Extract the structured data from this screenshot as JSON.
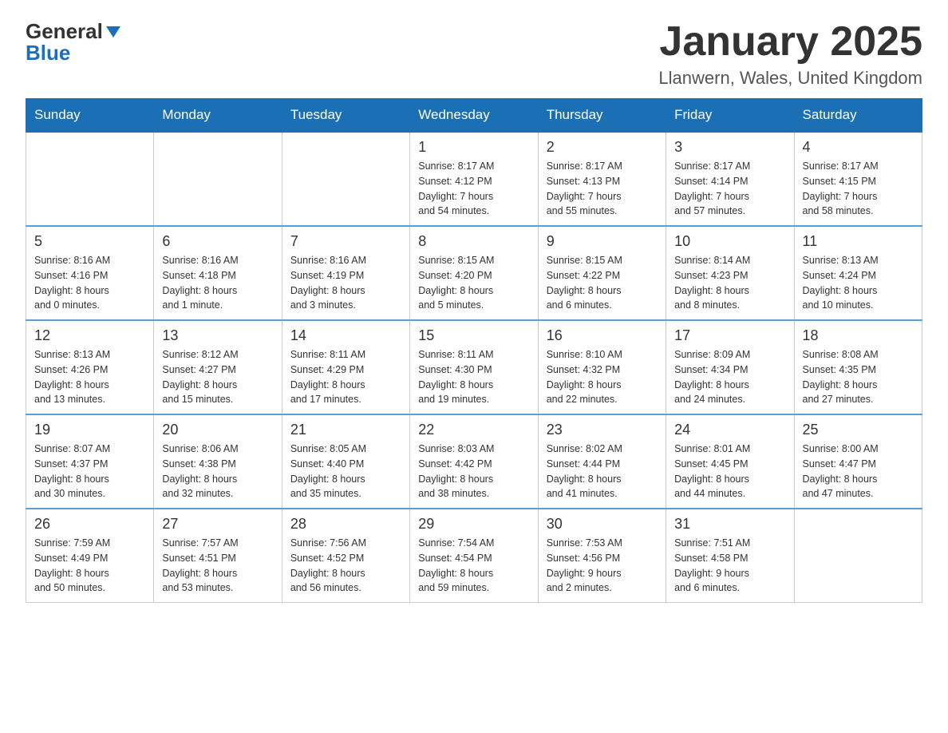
{
  "logo": {
    "text_general": "General",
    "text_blue": "Blue",
    "arrow_color": "#1a6fb5"
  },
  "header": {
    "month": "January 2025",
    "location": "Llanwern, Wales, United Kingdom"
  },
  "days_of_week": [
    "Sunday",
    "Monday",
    "Tuesday",
    "Wednesday",
    "Thursday",
    "Friday",
    "Saturday"
  ],
  "weeks": [
    [
      {
        "day": "",
        "info": ""
      },
      {
        "day": "",
        "info": ""
      },
      {
        "day": "",
        "info": ""
      },
      {
        "day": "1",
        "info": "Sunrise: 8:17 AM\nSunset: 4:12 PM\nDaylight: 7 hours\nand 54 minutes."
      },
      {
        "day": "2",
        "info": "Sunrise: 8:17 AM\nSunset: 4:13 PM\nDaylight: 7 hours\nand 55 minutes."
      },
      {
        "day": "3",
        "info": "Sunrise: 8:17 AM\nSunset: 4:14 PM\nDaylight: 7 hours\nand 57 minutes."
      },
      {
        "day": "4",
        "info": "Sunrise: 8:17 AM\nSunset: 4:15 PM\nDaylight: 7 hours\nand 58 minutes."
      }
    ],
    [
      {
        "day": "5",
        "info": "Sunrise: 8:16 AM\nSunset: 4:16 PM\nDaylight: 8 hours\nand 0 minutes."
      },
      {
        "day": "6",
        "info": "Sunrise: 8:16 AM\nSunset: 4:18 PM\nDaylight: 8 hours\nand 1 minute."
      },
      {
        "day": "7",
        "info": "Sunrise: 8:16 AM\nSunset: 4:19 PM\nDaylight: 8 hours\nand 3 minutes."
      },
      {
        "day": "8",
        "info": "Sunrise: 8:15 AM\nSunset: 4:20 PM\nDaylight: 8 hours\nand 5 minutes."
      },
      {
        "day": "9",
        "info": "Sunrise: 8:15 AM\nSunset: 4:22 PM\nDaylight: 8 hours\nand 6 minutes."
      },
      {
        "day": "10",
        "info": "Sunrise: 8:14 AM\nSunset: 4:23 PM\nDaylight: 8 hours\nand 8 minutes."
      },
      {
        "day": "11",
        "info": "Sunrise: 8:13 AM\nSunset: 4:24 PM\nDaylight: 8 hours\nand 10 minutes."
      }
    ],
    [
      {
        "day": "12",
        "info": "Sunrise: 8:13 AM\nSunset: 4:26 PM\nDaylight: 8 hours\nand 13 minutes."
      },
      {
        "day": "13",
        "info": "Sunrise: 8:12 AM\nSunset: 4:27 PM\nDaylight: 8 hours\nand 15 minutes."
      },
      {
        "day": "14",
        "info": "Sunrise: 8:11 AM\nSunset: 4:29 PM\nDaylight: 8 hours\nand 17 minutes."
      },
      {
        "day": "15",
        "info": "Sunrise: 8:11 AM\nSunset: 4:30 PM\nDaylight: 8 hours\nand 19 minutes."
      },
      {
        "day": "16",
        "info": "Sunrise: 8:10 AM\nSunset: 4:32 PM\nDaylight: 8 hours\nand 22 minutes."
      },
      {
        "day": "17",
        "info": "Sunrise: 8:09 AM\nSunset: 4:34 PM\nDaylight: 8 hours\nand 24 minutes."
      },
      {
        "day": "18",
        "info": "Sunrise: 8:08 AM\nSunset: 4:35 PM\nDaylight: 8 hours\nand 27 minutes."
      }
    ],
    [
      {
        "day": "19",
        "info": "Sunrise: 8:07 AM\nSunset: 4:37 PM\nDaylight: 8 hours\nand 30 minutes."
      },
      {
        "day": "20",
        "info": "Sunrise: 8:06 AM\nSunset: 4:38 PM\nDaylight: 8 hours\nand 32 minutes."
      },
      {
        "day": "21",
        "info": "Sunrise: 8:05 AM\nSunset: 4:40 PM\nDaylight: 8 hours\nand 35 minutes."
      },
      {
        "day": "22",
        "info": "Sunrise: 8:03 AM\nSunset: 4:42 PM\nDaylight: 8 hours\nand 38 minutes."
      },
      {
        "day": "23",
        "info": "Sunrise: 8:02 AM\nSunset: 4:44 PM\nDaylight: 8 hours\nand 41 minutes."
      },
      {
        "day": "24",
        "info": "Sunrise: 8:01 AM\nSunset: 4:45 PM\nDaylight: 8 hours\nand 44 minutes."
      },
      {
        "day": "25",
        "info": "Sunrise: 8:00 AM\nSunset: 4:47 PM\nDaylight: 8 hours\nand 47 minutes."
      }
    ],
    [
      {
        "day": "26",
        "info": "Sunrise: 7:59 AM\nSunset: 4:49 PM\nDaylight: 8 hours\nand 50 minutes."
      },
      {
        "day": "27",
        "info": "Sunrise: 7:57 AM\nSunset: 4:51 PM\nDaylight: 8 hours\nand 53 minutes."
      },
      {
        "day": "28",
        "info": "Sunrise: 7:56 AM\nSunset: 4:52 PM\nDaylight: 8 hours\nand 56 minutes."
      },
      {
        "day": "29",
        "info": "Sunrise: 7:54 AM\nSunset: 4:54 PM\nDaylight: 8 hours\nand 59 minutes."
      },
      {
        "day": "30",
        "info": "Sunrise: 7:53 AM\nSunset: 4:56 PM\nDaylight: 9 hours\nand 2 minutes."
      },
      {
        "day": "31",
        "info": "Sunrise: 7:51 AM\nSunset: 4:58 PM\nDaylight: 9 hours\nand 6 minutes."
      },
      {
        "day": "",
        "info": ""
      }
    ]
  ]
}
